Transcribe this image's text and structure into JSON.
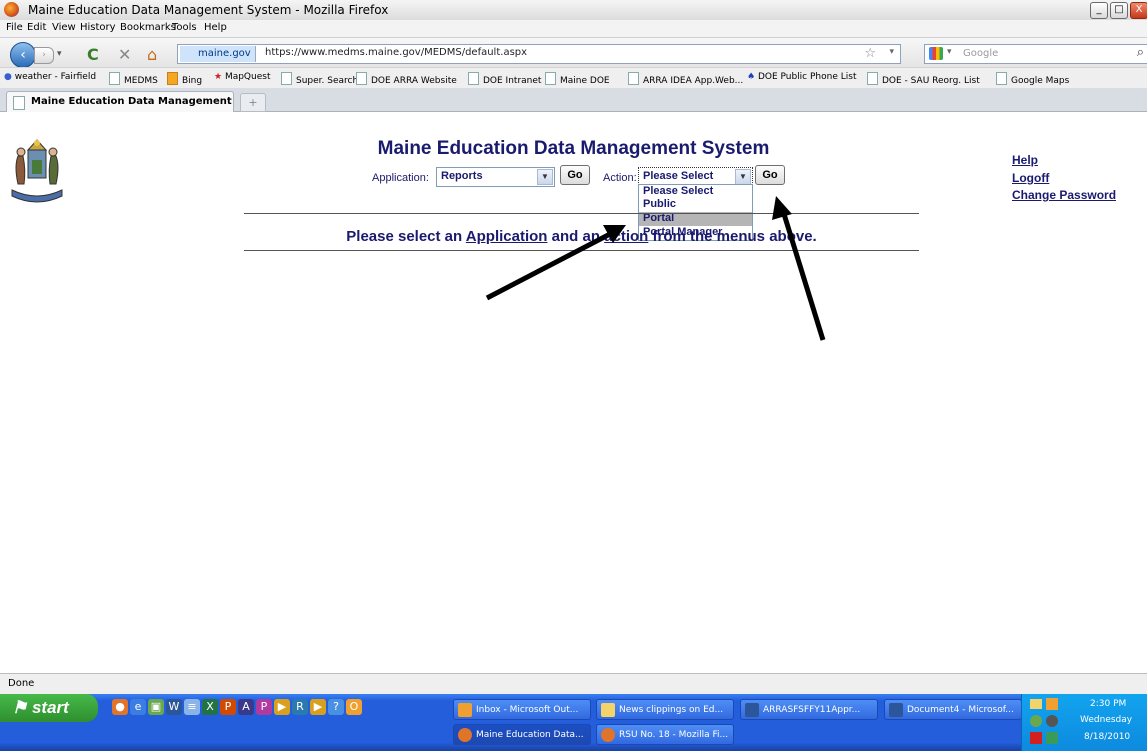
{
  "window": {
    "title": "Maine Education Data Management System - Mozilla Firefox",
    "min": "_",
    "max": "□",
    "close": "X"
  },
  "menubar": [
    "File",
    "Edit",
    "View",
    "History",
    "Bookmarks",
    "Tools",
    "Help"
  ],
  "navbar": {
    "identity": "maine.gov",
    "url": "https://www.medms.maine.gov/MEDMS/default.aspx",
    "search_placeholder": "Google"
  },
  "bookmarks": [
    "weather - Fairfield",
    "MEDMS",
    "Bing",
    "MapQuest",
    "Super. Search",
    "DOE ARRA Website",
    "DOE Intranet",
    "Maine DOE",
    "ARRA IDEA App.Web...",
    "DOE Public Phone List",
    "DOE - SAU Reorg. List",
    "Google Maps"
  ],
  "tab": {
    "label": "Maine Education Data Management ...",
    "new_tab": "+"
  },
  "page": {
    "title": "Maine Education Data Management System",
    "application_label": "Application:",
    "application_value": "Reports",
    "go_label": "Go",
    "action_label": "Action:",
    "action_value": "Please Select",
    "action_options": [
      "Please Select",
      "Public",
      "Portal",
      "Portal Manager"
    ],
    "highlighted_option": "Portal",
    "links": {
      "help": "Help",
      "logoff": "Logoff",
      "change_password": "Change Password"
    },
    "instruction_parts": {
      "part1": "Please select an ",
      "application": "Application",
      "part2": " and an ",
      "action": "action",
      "part3": " from the menus above."
    }
  },
  "status": {
    "text": "Done"
  },
  "taskbar": {
    "start": "start",
    "tasks_row1": [
      "Inbox - Microsoft Out...",
      "News clippings on Ed...",
      "ARRASFSFFY11Appr...",
      "Document4 - Microsof..."
    ],
    "tasks_row2": [
      "Maine Education Data...",
      "RSU No. 18 - Mozilla Fi..."
    ],
    "clock": {
      "time": "2:30 PM",
      "day": "Wednesday",
      "date": "8/18/2010"
    }
  }
}
